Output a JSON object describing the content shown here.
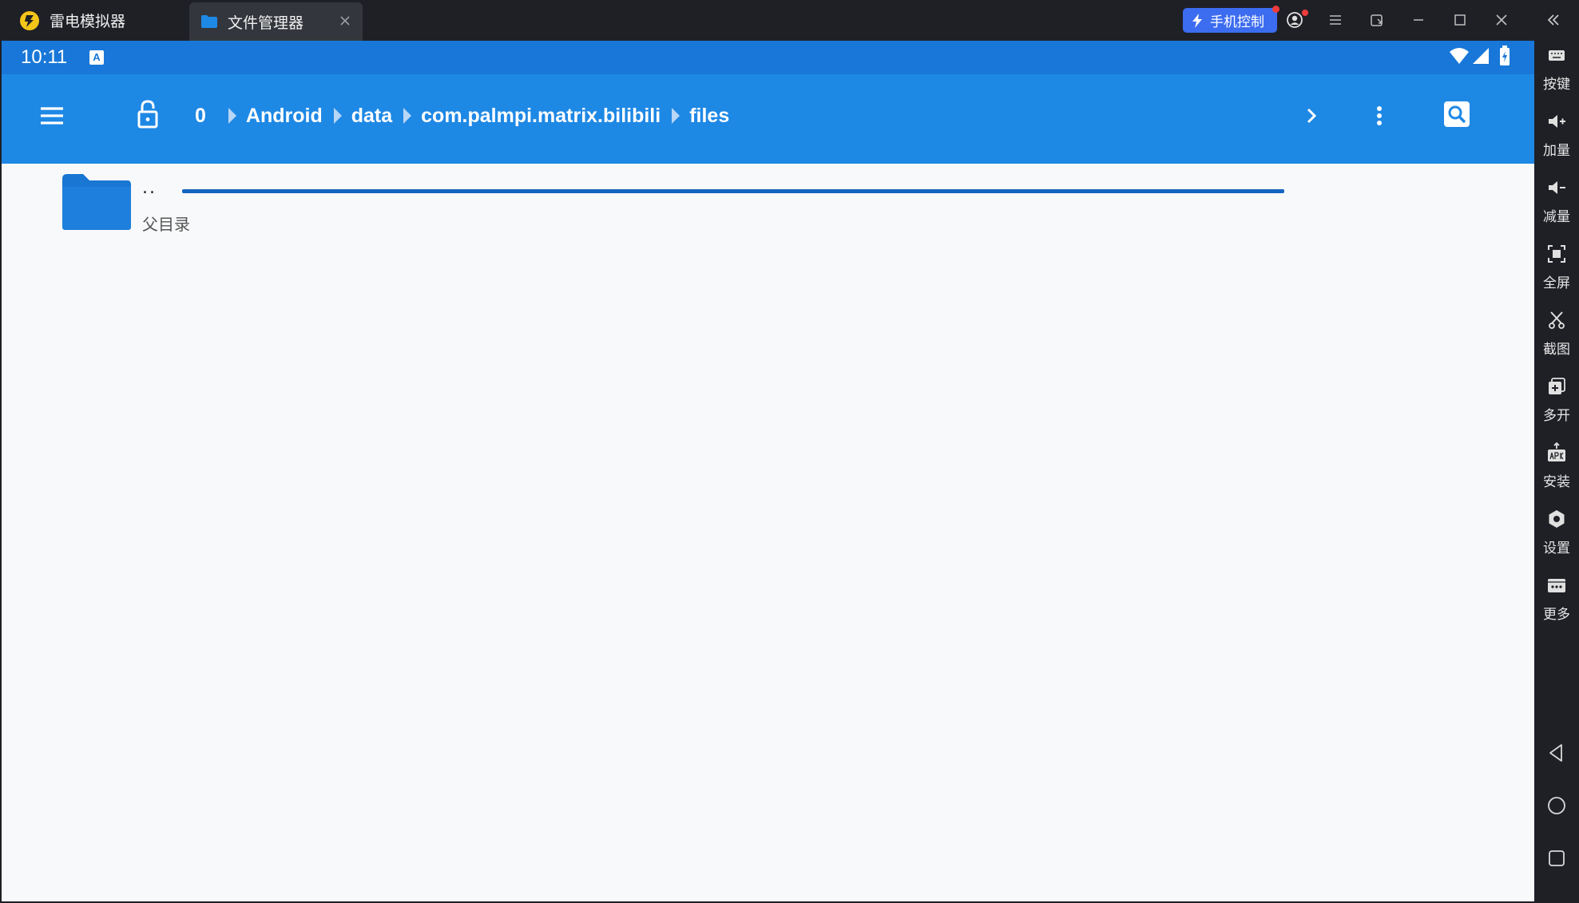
{
  "emulator": {
    "app_name": "雷电模拟器",
    "active_tab": "文件管理器",
    "phone_control": "手机控制",
    "colors": {
      "accent": "#3c6cf0",
      "titlebar": "#1f2026",
      "notify_dot": "#f03c3c"
    },
    "window_icons": [
      "account-icon",
      "menu-icon",
      "restore-window-icon",
      "minimize-icon",
      "maximize-icon",
      "close-icon",
      "collapse-sidebar-icon"
    ]
  },
  "sidebar": {
    "items": [
      {
        "label": "按键",
        "icon": "keyboard-icon"
      },
      {
        "label": "加量",
        "icon": "volume-up-icon"
      },
      {
        "label": "减量",
        "icon": "volume-down-icon"
      },
      {
        "label": "全屏",
        "icon": "fullscreen-icon"
      },
      {
        "label": "截图",
        "icon": "scissors-icon"
      },
      {
        "label": "多开",
        "icon": "multi-instance-icon"
      },
      {
        "label": "安装",
        "icon": "apk-install-icon"
      },
      {
        "label": "设置",
        "icon": "settings-icon"
      },
      {
        "label": "更多",
        "icon": "more-icon"
      }
    ],
    "nav": [
      "back-icon",
      "home-icon",
      "recents-icon"
    ]
  },
  "android": {
    "status_bar": {
      "time": "10:11",
      "badge": "A",
      "icons": [
        "wifi-icon",
        "signal-icon",
        "battery-icon"
      ]
    },
    "app_bar": {
      "colors": {
        "primary": "#1e88e5",
        "status": "#1877d8",
        "progress": "#1565c0"
      },
      "breadcrumb": [
        "0",
        "Android",
        "data",
        "com.palmpi.matrix.bilibili",
        "files"
      ]
    },
    "files": [
      {
        "name": "..",
        "description": "父目录",
        "icon": "folder-icon"
      }
    ]
  }
}
